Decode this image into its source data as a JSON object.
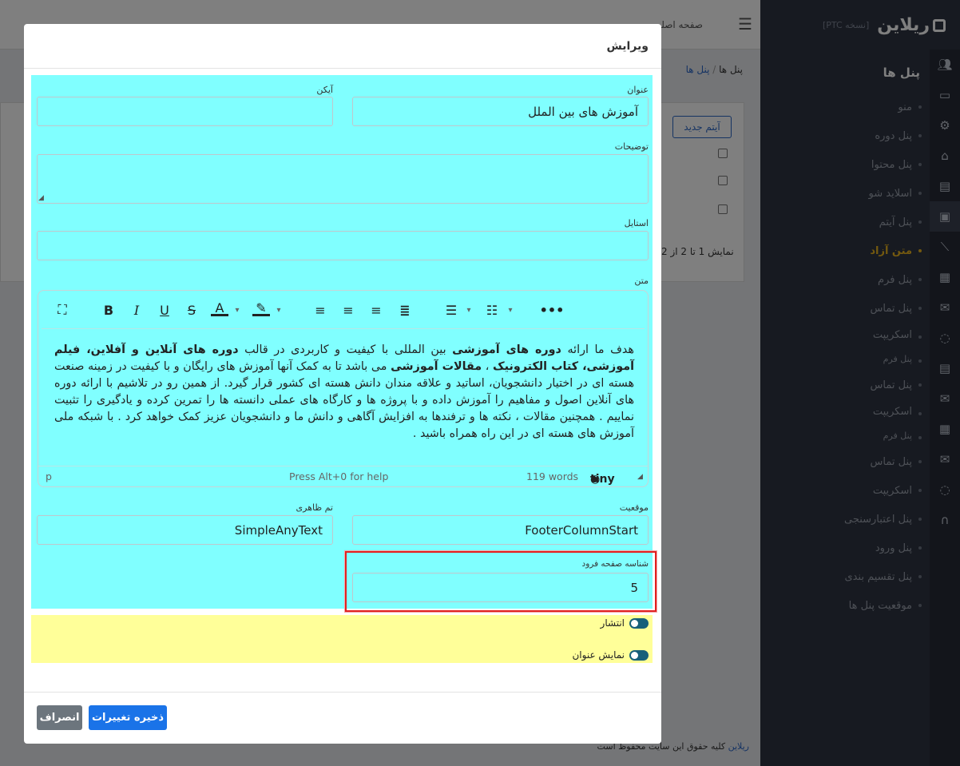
{
  "sidebar": {
    "logo": "ریلاین",
    "version": "[نسخه PTC]",
    "section_title": "پنل ها",
    "items": [
      {
        "label": "منو"
      },
      {
        "label": "پنل دوره"
      },
      {
        "label": "پنل محتوا"
      },
      {
        "label": "اسلاید شو"
      },
      {
        "label": "پنل آیتم"
      },
      {
        "label": "متن آزاد",
        "active": true
      },
      {
        "label": "پنل فرم"
      },
      {
        "label": "پنل تماس"
      },
      {
        "label": "اسکریپت"
      },
      {
        "label": "پنل فرم"
      },
      {
        "label": "پنل تماس"
      },
      {
        "label": "اسکریپت"
      },
      {
        "label": "پنل فرم"
      },
      {
        "label": "پنل تماس"
      },
      {
        "label": "اسکریپت"
      },
      {
        "label": "پنل اعتبارسنجی"
      },
      {
        "label": "پنل ورود"
      },
      {
        "label": "پنل تقسیم بندی"
      },
      {
        "label": "موقعیت پنل ها"
      }
    ],
    "icons": [
      "users-icon",
      "monitor-icon",
      "gear-icon",
      "basket-icon",
      "table-icon",
      "image-icon",
      "chart-icon",
      "calculator-icon",
      "mail-icon",
      "chat-icon",
      "table-icon",
      "mail-icon",
      "calculator-icon",
      "mail-icon",
      "chat-icon",
      "headset-icon"
    ]
  },
  "topbar": {
    "home_link": "صفحه اصلی"
  },
  "breadcrumb": {
    "root": "پنل ها",
    "current": "پنل ها"
  },
  "background_card": {
    "new_item_button": "آیتم جدید",
    "count_text": "نمایش 1 تا 2 از 2"
  },
  "footer": {
    "text": "کلیه حقوق این سایت محفوظ است",
    "link": "ریلاین"
  },
  "modal": {
    "title": "ویرایش",
    "fields": {
      "title_label": "عنوان",
      "title_value": "آموزش های بین الملل",
      "icon_label": "آیکن",
      "icon_value": "",
      "description_label": "توضیحات",
      "description_value": "",
      "style_label": "استایل",
      "style_value": "",
      "text_label": "متن",
      "position_label": "موقعیت",
      "position_value": "FooterColumnStart",
      "theme_label": "تم ظاهری",
      "theme_value": "SimpleAnyText",
      "landing_label": "شناسه صفحه فرود",
      "landing_value": "5"
    },
    "editor": {
      "toolbar": [
        "fullscreen-icon",
        "bold-icon",
        "italic-icon",
        "underline-icon",
        "strikethrough-icon",
        "text-color-icon",
        "highlight-icon",
        "align-left-icon",
        "align-center-icon",
        "align-right-icon",
        "align-justify-icon",
        "bullet-list-icon",
        "numbered-list-icon",
        "more-icon"
      ],
      "content": {
        "p1": "هدف ما ارائه ",
        "b1": "دوره های آموزشی",
        "p2": " بین المللی با کیفیت و کاربردی در قالب ",
        "b2": "دوره های آنلاین و آفلاین، فیلم آموزشی، کتاب الکترونیک",
        "p3": " ، ",
        "b3": "مقالات آموزشی",
        "p4": " می باشد تا به کمک آنها آموزش های رایگان و با کیفیت در زمینه صنعت هسته ای در اختیار دانشجویان، اساتید و علاقه مندان دانش هسته ای کشور قرار گیرد. از همین رو در تلاشیم با ارائه دوره های آنلاین اصول و مفاهیم را آموزش داده و با پروژه ها و کارگاه های عملی دانسته ها را تمرین کرده و یادگیری را تثبیت نماییم . همچنین مقالات ، نکته ها و ترفندها به افزایش آگاهی و دانش ما و دانشجویان عزیز کمک خواهد کرد . با شبکه ملی آموزش های هسته ای در این راه همراه باشید ."
      },
      "status_path": "p",
      "status_help": "Press Alt+0 for help",
      "word_count": "119 words",
      "brand": "tiny"
    },
    "toggles": {
      "publish_label": "انتشار",
      "publish_on": true,
      "show_title_label": "نمایش عنوان",
      "show_title_on": true
    },
    "buttons": {
      "save": "ذخیره تغییرات",
      "cancel": "انصراف"
    }
  },
  "colors": {
    "cyan_highlight": "#80ffff",
    "yellow_highlight": "#ffff99",
    "primary": "#1a73e8",
    "sidebar_bg": "#2e3442",
    "active_menu": "#e8b21e",
    "red_box": "#e02020"
  }
}
